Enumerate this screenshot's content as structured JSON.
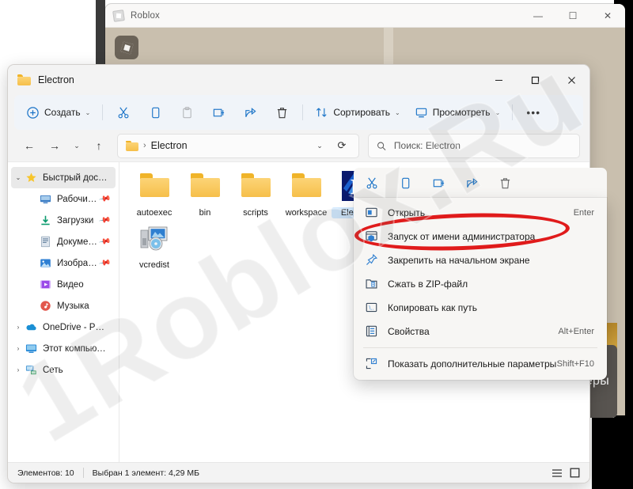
{
  "watermark": {
    "text": "1Roblox.Ru"
  },
  "background_window": {
    "title": "Roblox",
    "icon": "roblox-icon",
    "controls": {
      "minimize": "—",
      "maximize": "☐",
      "close": "✕"
    }
  },
  "background_tooltip": {
    "text": "еры"
  },
  "explorer": {
    "title": "Electron",
    "controls": {
      "minimize": "—",
      "maximize": "☐",
      "close": "✕"
    },
    "toolbar": {
      "new_label": "Создать",
      "cut_label": "Вырезать",
      "copy_label": "Копировать",
      "paste_label": "Вставить",
      "rename_label": "Переименовать",
      "share_label": "Поделиться",
      "delete_label": "Удалить",
      "sort_label": "Сортировать",
      "view_label": "Просмотреть",
      "more_label": "•••",
      "chevron": "⌄"
    },
    "address": {
      "back": "←",
      "forward": "→",
      "recent": "⌄",
      "up": "↑",
      "root_icon": "folder-icon",
      "separator": "›",
      "path_name": "Electron",
      "dropdown": "⌄",
      "refresh": "⟳"
    },
    "search": {
      "placeholder": "Поиск: Electron",
      "value": ""
    },
    "nav_pane": {
      "items": [
        {
          "label": "Быстрый доступ",
          "expander": "⌄",
          "icon": "star-icon",
          "pinned": false,
          "selected": true,
          "indent": false
        },
        {
          "label": "Рабочий стол",
          "expander": "",
          "icon": "desktop-icon",
          "pinned": true,
          "selected": false,
          "indent": true
        },
        {
          "label": "Загрузки",
          "expander": "",
          "icon": "downloads-icon",
          "pinned": true,
          "selected": false,
          "indent": true
        },
        {
          "label": "Документы",
          "expander": "",
          "icon": "documents-icon",
          "pinned": true,
          "selected": false,
          "indent": true
        },
        {
          "label": "Изображения",
          "expander": "",
          "icon": "pictures-icon",
          "pinned": true,
          "selected": false,
          "indent": true
        },
        {
          "label": "Видео",
          "expander": "",
          "icon": "videos-icon",
          "pinned": false,
          "selected": false,
          "indent": true
        },
        {
          "label": "Музыка",
          "expander": "",
          "icon": "music-icon",
          "pinned": false,
          "selected": false,
          "indent": true
        },
        {
          "label": "OneDrive - Personal",
          "expander": "›",
          "icon": "onedrive-icon",
          "pinned": false,
          "selected": false,
          "indent": false
        },
        {
          "label": "Этот компьютер",
          "expander": "›",
          "icon": "this-pc-icon",
          "pinned": false,
          "selected": false,
          "indent": false
        },
        {
          "label": "Сеть",
          "expander": "›",
          "icon": "network-icon",
          "pinned": false,
          "selected": false,
          "indent": false
        }
      ]
    },
    "files": [
      {
        "name": "autoexec",
        "type": "folder",
        "selected": false
      },
      {
        "name": "bin",
        "type": "folder",
        "selected": false
      },
      {
        "name": "scripts",
        "type": "folder",
        "selected": false
      },
      {
        "name": "workspace",
        "type": "folder",
        "selected": false
      },
      {
        "name": "Electron",
        "type": "electron",
        "selected": true
      },
      {
        "name": "vcredist",
        "type": "installer",
        "selected": false
      }
    ],
    "status": {
      "item_count": "Элементов: 10",
      "selection": "Выбран 1 элемент: 4,29 МБ",
      "view_details": "details-view-icon",
      "view_large": "large-icons-view-icon"
    }
  },
  "context_menu": {
    "command_bar": [
      {
        "name": "cut",
        "label": "Вырезать"
      },
      {
        "name": "copy",
        "label": "Копировать"
      },
      {
        "name": "rename",
        "label": "Переименовать"
      },
      {
        "name": "share",
        "label": "Поделиться"
      },
      {
        "name": "delete",
        "label": "Удалить"
      }
    ],
    "items": [
      {
        "label": "Открыть",
        "accel": "Enter",
        "icon": "open-icon"
      },
      {
        "label": "Запуск от имени администратора",
        "accel": "",
        "icon": "shield-icon"
      },
      {
        "label": "Закрепить на начальном экране",
        "accel": "",
        "icon": "pin-start-icon"
      },
      {
        "label": "Сжать в ZIP-файл",
        "accel": "",
        "icon": "zip-icon"
      },
      {
        "label": "Копировать как путь",
        "accel": "",
        "icon": "copy-path-icon"
      },
      {
        "label": "Свойства",
        "accel": "Alt+Enter",
        "icon": "properties-icon"
      },
      {
        "label": "Показать дополнительные параметры",
        "accel": "Shift+F10",
        "icon": "more-options-icon"
      }
    ]
  },
  "annotation": {
    "shape": "ellipse",
    "color": "#e01b1b",
    "targets": "Запуск от имени администратора"
  }
}
